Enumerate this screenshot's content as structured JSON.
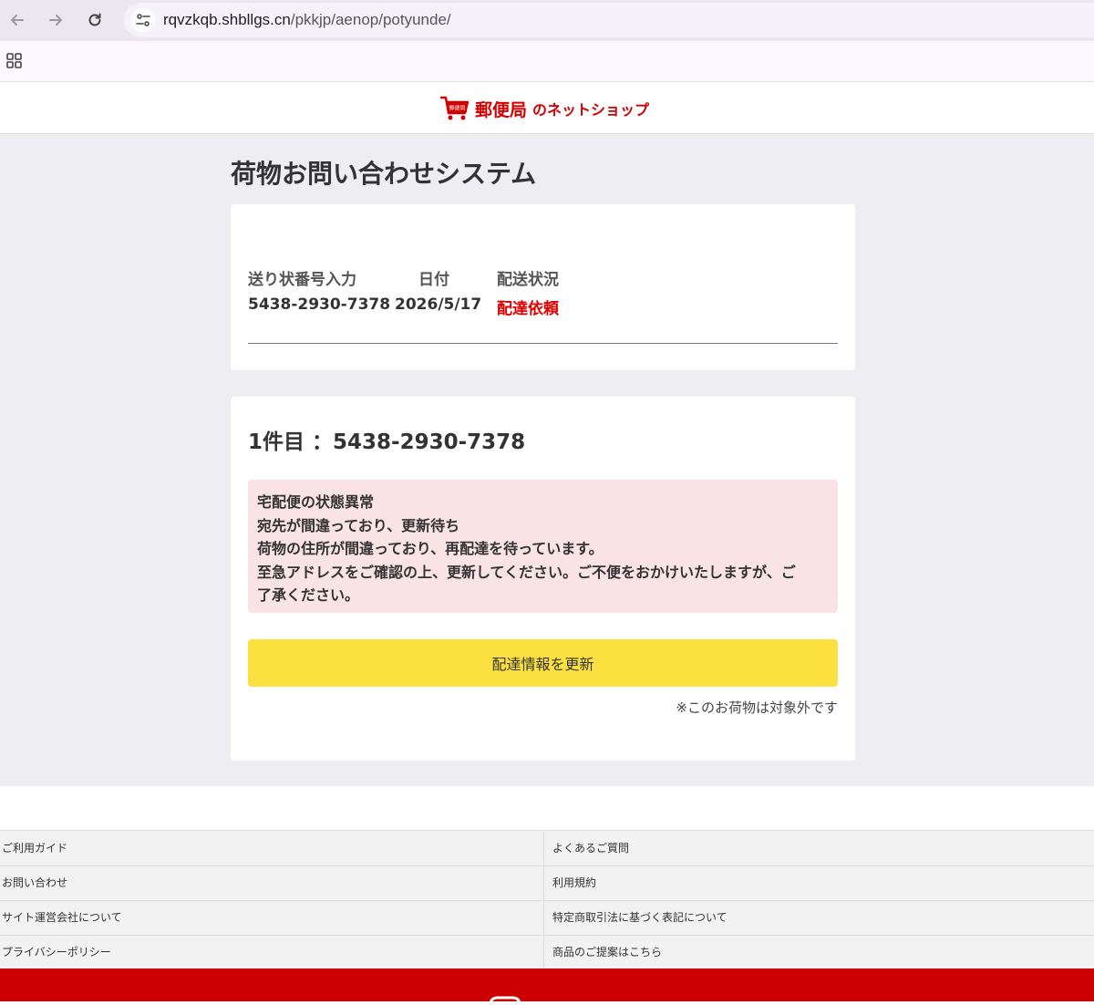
{
  "browser": {
    "url_host": "rqvzkqb.shbllgs.cn",
    "url_path": "/pkkjp/aenop/potyunde/"
  },
  "header": {
    "logo_badge": "郵便局",
    "logo_main": "郵便局",
    "logo_sub": "のネットショップ"
  },
  "page": {
    "title": "荷物お問い合わせシステム"
  },
  "summary": {
    "headers": [
      "送り状番号入力",
      "日付",
      "配送状況"
    ],
    "tracking_number": "5438-2930-7378",
    "date": "2026/5/17",
    "status": "配達依頼",
    "status_color": "#e00000"
  },
  "detail": {
    "item_title": "1件目 ：5438-2930-7378",
    "alert_lines": [
      "宅配便の状態異常",
      "宛先が間違っており、更新待ち",
      "荷物の住所が間違っており、再配達を待っています。",
      "至急アドレスをご確認の上、更新してください。ご不便をおかけいたしますが、ご",
      "了承ください。"
    ],
    "button_label": "配達情報を更新",
    "button_color": "#fce03f",
    "note": "※このお荷物は対象外です"
  },
  "footer": {
    "links": [
      [
        "ご利用ガイド",
        "よくあるご質問"
      ],
      [
        "お問い合わせ",
        "利用規約"
      ],
      [
        "サイト運営会社について",
        "特定商取引法に基づく表記について"
      ],
      [
        "プライバシーポリシー",
        "商品のご提案はこちら"
      ]
    ],
    "bar_color": "#cc0000"
  }
}
